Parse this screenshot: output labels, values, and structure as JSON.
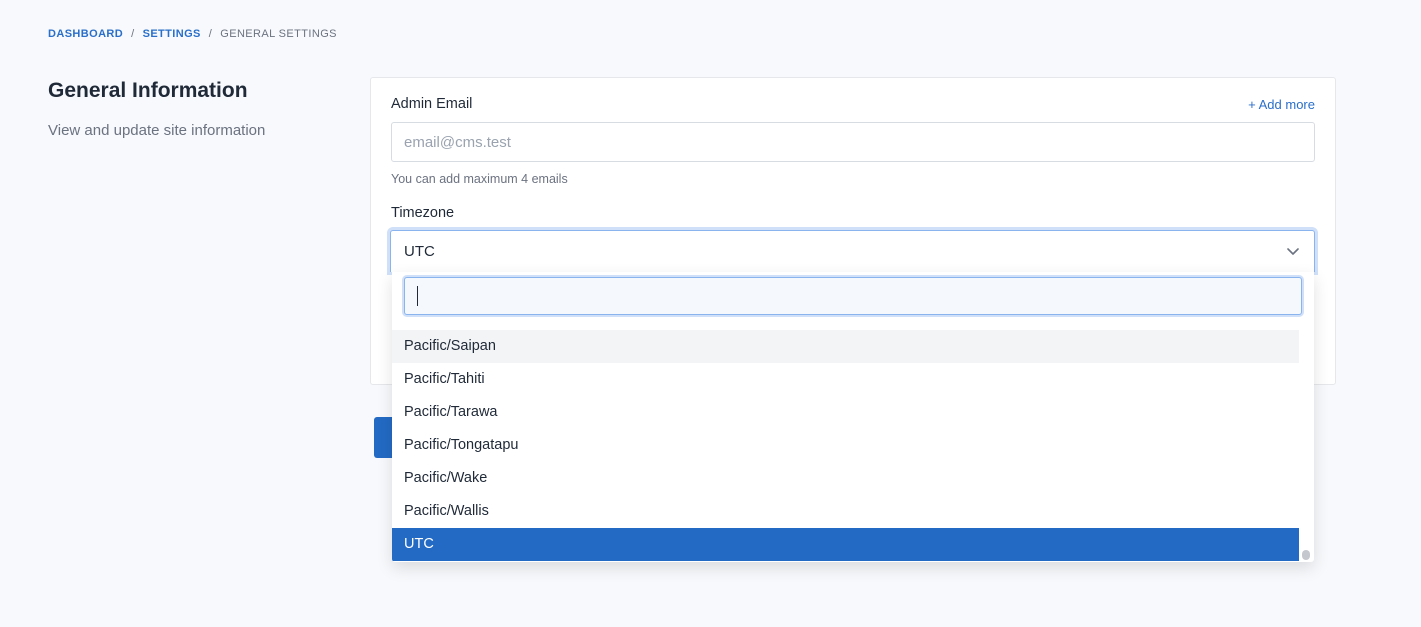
{
  "breadcrumb": {
    "items": [
      "DASHBOARD",
      "SETTINGS",
      "GENERAL SETTINGS"
    ],
    "separator": "/"
  },
  "section": {
    "title": "General Information",
    "description": "View and update site information"
  },
  "admin_email": {
    "label": "Admin Email",
    "add_more": "+ Add more",
    "placeholder": "email@cms.test",
    "value": "",
    "helper": "You can add maximum 4 emails"
  },
  "timezone": {
    "label": "Timezone",
    "selected": "UTC",
    "search_value": "",
    "options": [
      "Pacific/Saipan",
      "Pacific/Tahiti",
      "Pacific/Tarawa",
      "Pacific/Tongatapu",
      "Pacific/Wake",
      "Pacific/Wallis",
      "UTC"
    ],
    "hovered_option": "Pacific/Saipan"
  },
  "colors": {
    "accent": "#236ac4",
    "link": "#2a6fc9",
    "focus_ring": "#cfe0f8"
  }
}
